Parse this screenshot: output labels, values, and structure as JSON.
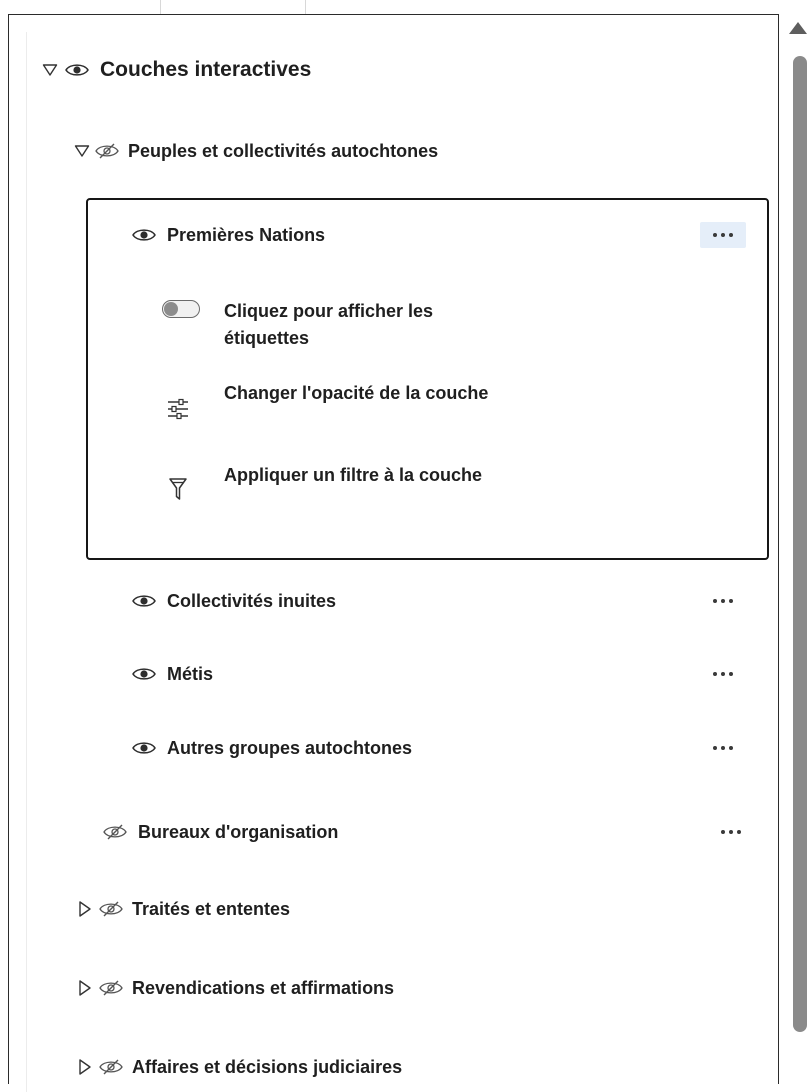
{
  "panel": {
    "root_group": {
      "label": "Couches interactives",
      "expanded": true
    },
    "group_peuples": {
      "label": "Peuples et collectivités autochtones",
      "expanded": true,
      "visible": false
    },
    "selected_layer": {
      "label": "Premières Nations",
      "actions_icon": "more-horizontal-icon",
      "options": [
        {
          "icon": "toggle-switch",
          "label": "Cliquez pour afficher les étiquettes",
          "state": "off"
        },
        {
          "icon": "sliders-icon",
          "label": "Changer l'opacité de la couche"
        },
        {
          "icon": "filter-icon",
          "label": "Appliquer un filtre à la couche"
        }
      ]
    },
    "sub_layers": [
      {
        "label": "Collectivités inuites"
      },
      {
        "label": "Métis"
      },
      {
        "label": "Autres groupes autochtones"
      }
    ],
    "bureaux": {
      "label": "Bureaux d'organisation",
      "visible": false
    },
    "collapsed_groups": [
      {
        "label": "Traités et ententes",
        "visible": false
      },
      {
        "label": "Revendications et affirmations",
        "visible": false
      },
      {
        "label": "Affaires et décisions judiciaires",
        "visible": false
      }
    ]
  },
  "colors": {
    "text": "#1f1f1f",
    "card_border": "#161616",
    "active_dots_bg": "#e5eef9",
    "scroll_thumb": "#8a8a8a"
  }
}
